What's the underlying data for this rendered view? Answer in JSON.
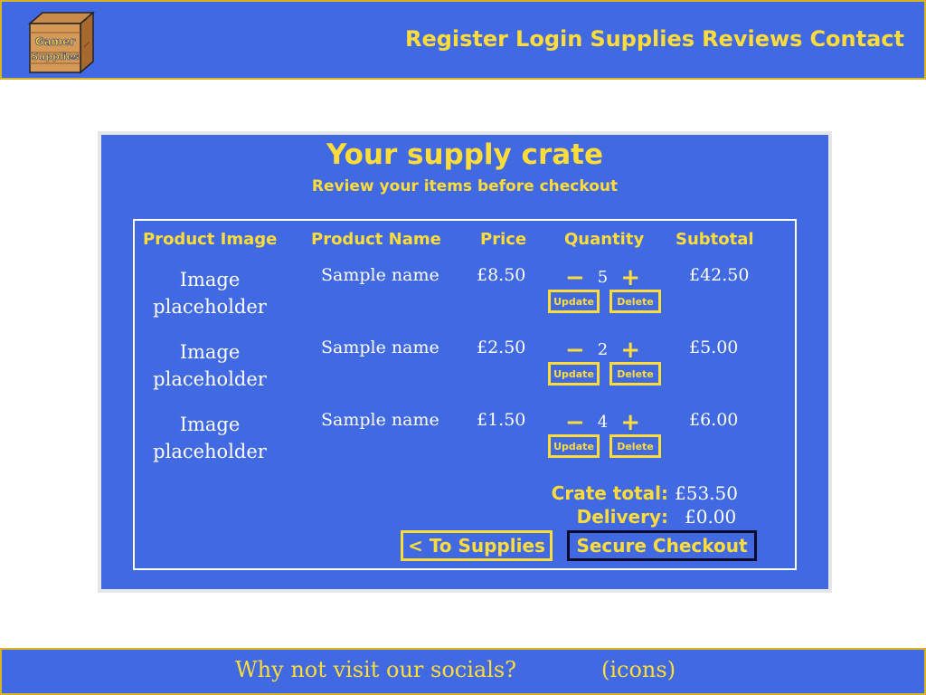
{
  "logo": {
    "text_line1": "Gamer",
    "text_line2": "Supplies"
  },
  "nav": {
    "items": [
      "Register",
      "Login",
      "Supplies",
      "Reviews",
      "Contact"
    ]
  },
  "card": {
    "title": "Your supply crate",
    "subtitle": "Review your items before checkout"
  },
  "table": {
    "headers": [
      "Product Image",
      "Product Name",
      "Price",
      "Quantity",
      "Subtotal"
    ],
    "rows": [
      {
        "image_line1": "Image",
        "image_line2": "placeholder",
        "name": "Sample name",
        "price": "£8.50",
        "quantity": "5",
        "subtotal": "£42.50"
      },
      {
        "image_line1": "Image",
        "image_line2": "placeholder",
        "name": "Sample name",
        "price": "£2.50",
        "quantity": "2",
        "subtotal": "£5.00"
      },
      {
        "image_line1": "Image",
        "image_line2": "placeholder",
        "name": "Sample name",
        "price": "£1.50",
        "quantity": "4",
        "subtotal": "£6.00"
      }
    ],
    "decrement_symbol": "−",
    "increment_symbol": "+",
    "update_label": "Update",
    "delete_label": "Delete"
  },
  "totals": {
    "crate_total_label": "Crate total:",
    "crate_total_value": "£53.50",
    "delivery_label": "Delivery:",
    "delivery_value": "£0.00"
  },
  "actions": {
    "back_label": "< To Supplies",
    "checkout_label": "Secure Checkout"
  },
  "footer": {
    "text": "Why not visit our socials?",
    "icons_placeholder": "(icons)"
  },
  "colors": {
    "primary_blue": "#4169e1",
    "accent_yellow": "#fedd3a",
    "text_white": "#ffffff"
  }
}
